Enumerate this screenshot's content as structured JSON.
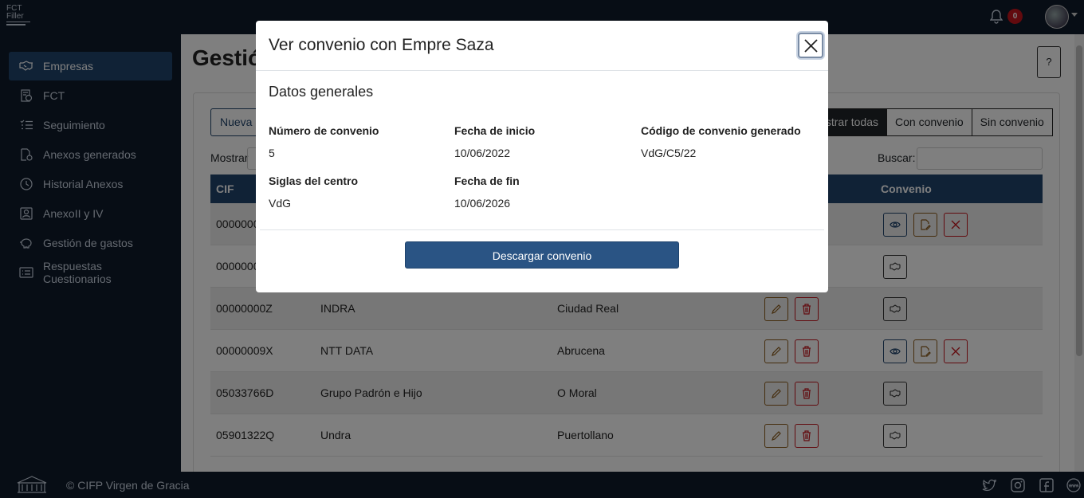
{
  "app": {
    "logo_line1": "FCT",
    "logo_line2": "Filler",
    "notification_count": "0"
  },
  "sidebar": {
    "items": [
      {
        "label": "Empresas",
        "icon": "handshake-icon",
        "active": true
      },
      {
        "label": "FCT",
        "icon": "fct-document-icon"
      },
      {
        "label": "Seguimiento",
        "icon": "list-check-icon"
      },
      {
        "label": "Anexos generados",
        "icon": "document-gear-icon"
      },
      {
        "label": "Historial Anexos",
        "icon": "clock-history-icon"
      },
      {
        "label": "AnexoII y IV",
        "icon": "person-badge-icon"
      },
      {
        "label": "Gestión de gastos",
        "icon": "piggy-bank-icon"
      },
      {
        "label": "Respuestas Cuestionarios",
        "icon": "card-list-icon"
      }
    ]
  },
  "main": {
    "title": "Gestió",
    "help_label": "?",
    "new_button": "Nueva e",
    "filters": [
      "strar todas",
      "Con convenio",
      "Sin convenio"
    ],
    "show_label": "Mostrar",
    "search_label": "Buscar:",
    "columns": {
      "cif": "CIF",
      "convenio": "Convenio"
    },
    "rows": [
      {
        "cif": "0000000",
        "name": "",
        "city": "",
        "actions": "partial-convenio"
      },
      {
        "cif": "0000000",
        "name": "",
        "city": "",
        "actions": "partial-sin"
      },
      {
        "cif": "00000000Z",
        "name": "INDRA",
        "city": "Ciudad Real",
        "actions": "sin"
      },
      {
        "cif": "00000009X",
        "name": "NTT DATA",
        "city": "Abrucena",
        "actions": "con"
      },
      {
        "cif": "05033766D",
        "name": "Grupo Padrón e Hijo",
        "city": "O Moral",
        "actions": "sin"
      },
      {
        "cif": "05901322Q",
        "name": "Undra",
        "city": "Puertollano",
        "actions": "sin"
      }
    ]
  },
  "footer": {
    "copyright": "© CIFP Virgen de Gracia"
  },
  "modal": {
    "title": "Ver convenio con Empre Saza",
    "section_title": "Datos generales",
    "fields": {
      "numero_label": "Número de convenio",
      "numero_value": "5",
      "inicio_label": "Fecha de inicio",
      "inicio_value": "10/06/2022",
      "codigo_label": "Código de convenio generado",
      "codigo_value": "VdG/C5/22",
      "siglas_label": "Siglas del centro",
      "siglas_value": "VdG",
      "fin_label": "Fecha de fin",
      "fin_value": "10/06/2026"
    },
    "download_label": "Descargar convenio"
  },
  "colors": {
    "primary": "#20446d",
    "danger": "#c4151c",
    "warning": "#8a5a1a",
    "dark_bg": "#0e1a2b"
  }
}
